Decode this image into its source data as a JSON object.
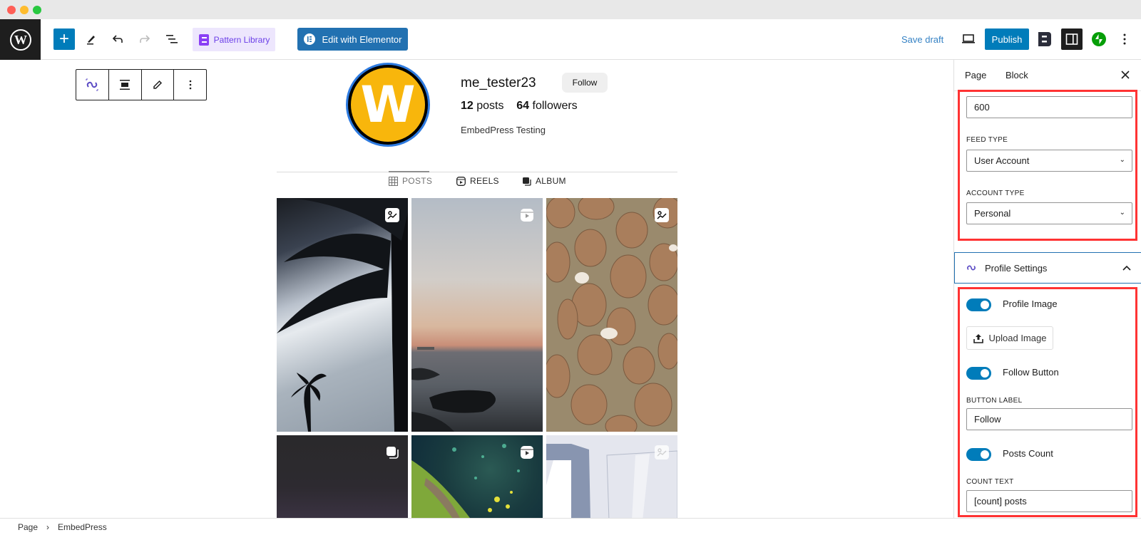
{
  "window": {
    "traffic_lights": {
      "close": "#ff5f57",
      "minimize": "#febc2e",
      "maximize": "#28c840"
    }
  },
  "toolbar": {
    "wp_logo": "wordpress-logo",
    "add_label": "+",
    "pattern_library_label": "Pattern Library",
    "edit_elementor_label": "Edit with Elementor",
    "save_draft_label": "Save draft",
    "publish_label": "Publish"
  },
  "profile": {
    "username": "me_tester23",
    "follow_label": "Follow",
    "posts_count": "12",
    "posts_word": "posts",
    "followers_count": "64",
    "followers_word": "followers",
    "bio": "EmbedPress Testing",
    "avatar_letter": "W"
  },
  "feed_tabs": [
    {
      "label": "POSTS",
      "icon": "grid-icon",
      "active": true
    },
    {
      "label": "REELS",
      "icon": "reels-icon",
      "active": false
    },
    {
      "label": "ALBUM",
      "icon": "album-icon",
      "active": false
    }
  ],
  "posts": [
    {
      "type": "image",
      "desc": "palm tree silhouette against sky"
    },
    {
      "type": "reel",
      "desc": "sunset over sea with rocks"
    },
    {
      "type": "image",
      "desc": "brown dumplings in sauce"
    },
    {
      "type": "album",
      "desc": "dark night sky"
    },
    {
      "type": "reel",
      "desc": "green moss and leaves"
    },
    {
      "type": "image",
      "desc": "grey placeholder building"
    }
  ],
  "sidebar": {
    "tabs": [
      {
        "label": "Page"
      },
      {
        "label": "Block",
        "active": true
      }
    ],
    "width_value": "600",
    "feed_type_label": "FEED TYPE",
    "feed_type_value": "User Account",
    "account_type_label": "ACCOUNT TYPE",
    "account_type_value": "Personal",
    "profile_settings_title": "Profile Settings",
    "profile_image_label": "Profile Image",
    "profile_image_on": true,
    "upload_label": "Upload Image",
    "follow_button_label": "Follow Button",
    "follow_button_on": true,
    "button_label_label": "BUTTON LABEL",
    "button_label_value": "Follow",
    "posts_count_label": "Posts Count",
    "posts_count_on": true,
    "count_text_label": "COUNT TEXT",
    "count_text_value": "[count] posts"
  },
  "breadcrumb": {
    "items": [
      "Page",
      "EmbedPress"
    ],
    "separator": "›"
  }
}
